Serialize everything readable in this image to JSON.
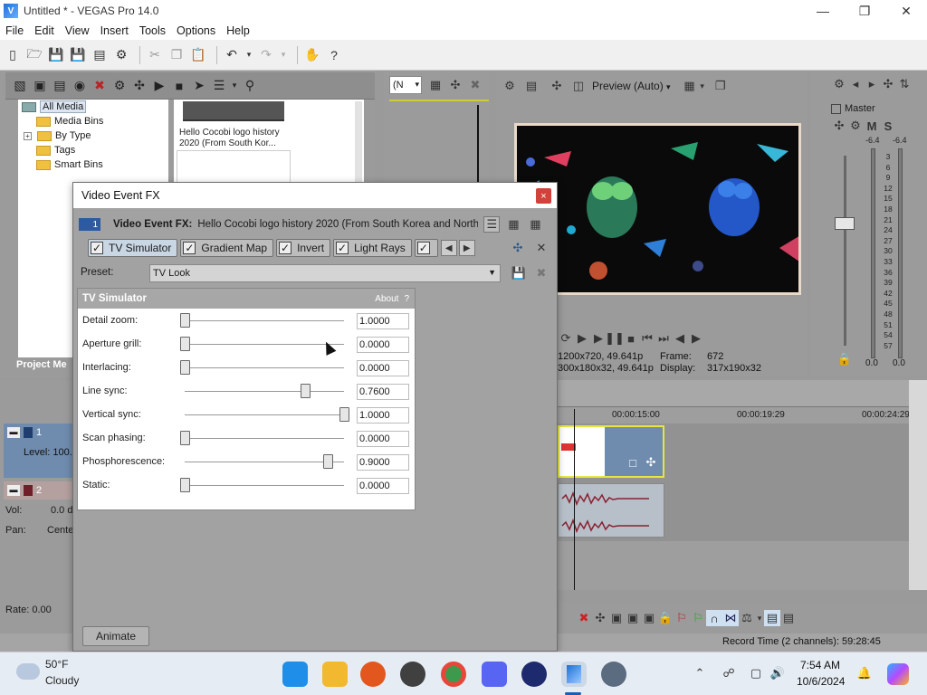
{
  "window": {
    "title": "Untitled * - VEGAS Pro 14.0"
  },
  "menu": [
    "File",
    "Edit",
    "View",
    "Insert",
    "Tools",
    "Options",
    "Help"
  ],
  "project_media": {
    "tree": [
      "All Media",
      "Media Bins",
      "By Type",
      "Tags",
      "Smart Bins"
    ],
    "clip_name": "Hello Cocobi logo history 2020 (From South Kor...",
    "tab_label": "Project Me"
  },
  "trimmer": {
    "dropdown_value": "(N"
  },
  "preview": {
    "quality": "Preview (Auto)",
    "project_info": "1200x720, 49.641p",
    "preview_info": "300x180x32, 49.641p",
    "frame_label": "Frame:",
    "frame_value": "672",
    "display_label": "Display:",
    "display_value": "317x190x32"
  },
  "master": {
    "label": "Master",
    "peak_left": "-6.4",
    "peak_right": "-6.4",
    "scale": [
      "3",
      "6",
      "9",
      "12",
      "15",
      "18",
      "21",
      "24",
      "27",
      "30",
      "33",
      "36",
      "39",
      "42",
      "45",
      "48",
      "51",
      "54",
      "57"
    ],
    "val_left": "0.0",
    "val_right": "0.0"
  },
  "tracks": {
    "video_num": "1",
    "video_level": "Level: 100.",
    "audio_num": "2",
    "vol_label": "Vol:",
    "vol_value": "0.0 d",
    "pan_label": "Pan:",
    "pan_value": "Cente",
    "rate": "Rate: 0.00"
  },
  "timeline": {
    "ruler": [
      "00:00:15:00",
      "00:00:19:29",
      "00:00:24:29"
    ]
  },
  "status": {
    "record_time": "Record Time (2 channels): 59:28:45"
  },
  "dialog": {
    "title": "Video Event FX",
    "close": "×",
    "track_num": "1",
    "fx_label": "Video Event FX:",
    "fx_event": "Hello Cocobi logo history 2020 (From South Korea and North",
    "chain": [
      "TV Simulator",
      "Gradient Map",
      "Invert",
      "Light Rays"
    ],
    "preset_label": "Preset:",
    "preset_value": "TV Look",
    "plugin_title": "TV Simulator",
    "about": "About",
    "help": "?",
    "animate": "Animate",
    "params": [
      {
        "label": "Detail zoom:",
        "value": "1.0000",
        "fill": 0.0
      },
      {
        "label": "Aperture grill:",
        "value": "0.0000",
        "fill": 0.0
      },
      {
        "label": "Interlacing:",
        "value": "0.0000",
        "fill": 0.0
      },
      {
        "label": "Line sync:",
        "value": "0.7600",
        "fill": 0.76
      },
      {
        "label": "Vertical sync:",
        "value": "1.0000",
        "fill": 1.0
      },
      {
        "label": "Scan phasing:",
        "value": "0.0000",
        "fill": 0.0
      },
      {
        "label": "Phosphorescence:",
        "value": "0.9000",
        "fill": 0.9
      },
      {
        "label": "Static:",
        "value": "0.0000",
        "fill": 0.0
      }
    ]
  },
  "taskbar": {
    "temp": "50°F",
    "weather": "Cloudy",
    "time": "7:54 AM",
    "date": "10/6/2024"
  }
}
